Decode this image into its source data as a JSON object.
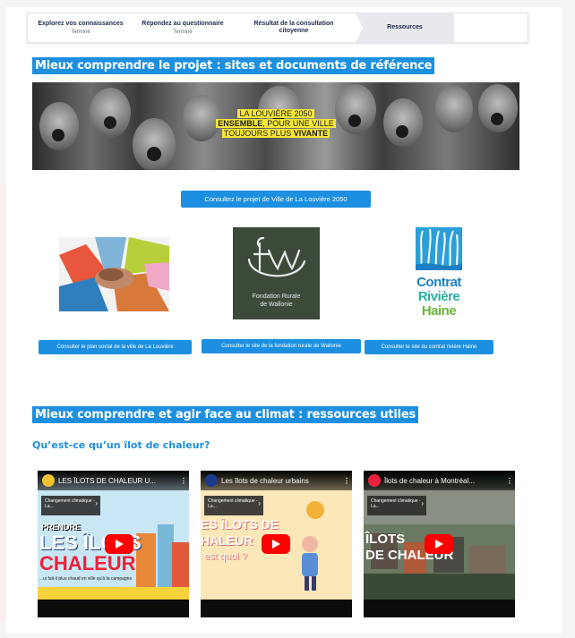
{
  "stepper": {
    "steps": [
      {
        "label": "Explorez vos connaissances",
        "status": "Terminé"
      },
      {
        "label": "Répondez au questionnaire",
        "status": "Terminé"
      },
      {
        "label": "Résultat de la consultation citoyenne",
        "status": ""
      },
      {
        "label": "Ressources",
        "status": ""
      }
    ],
    "active_index": 3
  },
  "section1": {
    "title": "Mieux comprendre le projet : sites et documents de référence",
    "banner": {
      "line1": "LA LOUVIÈRE 2050",
      "line2_bold": "ENSEMBLE",
      "line2_rest": ", POUR UNE VILLE",
      "line3_rest": "TOUJOURS PLUS ",
      "line3_bold": "VIVANTE"
    },
    "main_button": "Consultez le projet de Ville de La Louvière 2050",
    "partners": [
      {
        "button": "Consulter le plan social de la ville de La Louvière"
      },
      {
        "logo_text_1": "Fondation Rurale",
        "logo_text_2": "de Wallonie",
        "logo_mark": "frw",
        "button": "Consulter le site de la fondation rurale de Wallonie"
      },
      {
        "logo_words": [
          "Contrat",
          "Rivière",
          "Haine"
        ],
        "button": "Consulter le site du contrat rivière Haine"
      }
    ]
  },
  "section2": {
    "title": "Mieux comprendre et agir face au climat : ressources utiles",
    "subtitle": "Qu’est-ce qu’un îlot de chaleur?",
    "videos": [
      {
        "title": "LES ÎLOTS DE CHALEUR U...",
        "card": "Changement climatique - La...",
        "thumb_text_1": "PRENDRE",
        "thumb_text_2": "LES ÎLOTS",
        "thumb_text_3": "CHALEUR",
        "thumb_caption": "...ui fait-il plus chaud en ville qu'à la campagne"
      },
      {
        "title": "Les îlots de chaleur urbains",
        "card": "Changement climatique - La...",
        "thumb_text_1": "ES ÎLOTS DE",
        "thumb_text_2": "HALEUR",
        "thumb_text_3": "est quoi ?"
      },
      {
        "title": "Îlots de chaleur à Montréal...",
        "card": "Changement climatique - La...",
        "thumb_text_1": "ÎLOTS",
        "thumb_text_2": "DE CHALEUR"
      }
    ]
  },
  "colors": {
    "accent": "#1d8fe0",
    "highlight_yellow": "#f5e637",
    "frw_green": "#3c4a3a",
    "youtube_red": "#ff0000"
  }
}
